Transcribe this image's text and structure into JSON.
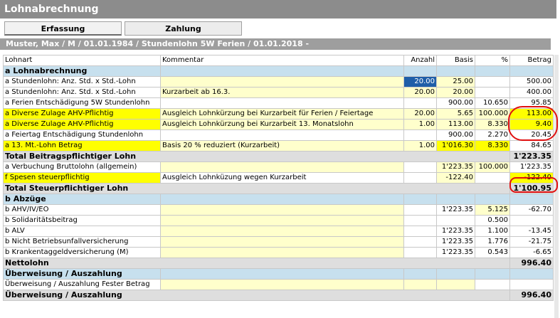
{
  "app": {
    "title": "Lohnabrechnung"
  },
  "tabs": [
    {
      "label": "Erfassung"
    },
    {
      "label": "Zahlung"
    }
  ],
  "employee": {
    "line": "Muster, Max / M / 01.01.1984 / Stundenlohn 5W Ferien / 01.01.2018 -"
  },
  "columns": {
    "lohnart": "Lohnart",
    "kommentar": "Kommentar",
    "anzahl": "Anzahl",
    "basis": "Basis",
    "pct": "%",
    "betrag": "Betrag"
  },
  "rows": [
    {
      "type": "section",
      "label": "a  Lohnabrechnung"
    },
    {
      "type": "item",
      "lohnart": "a  Stundenlohn: Anz. Std. x Std.-Lohn",
      "kommentar": "",
      "anzahl": "20.00",
      "basis": "25.00",
      "pct": "",
      "betrag": "500.00",
      "hl": [],
      "yl": [
        "kommentar",
        "basis"
      ],
      "sel": [
        "anzahl"
      ]
    },
    {
      "type": "item",
      "lohnart": "a  Stundenlohn: Anz. Std. x Std.-Lohn",
      "kommentar": "Kurzarbeit ab 16.3.",
      "anzahl": "20.00",
      "basis": "20.00",
      "pct": "",
      "betrag": "400.00",
      "hl": [],
      "yl": [
        "kommentar",
        "anzahl",
        "basis"
      ],
      "sel": []
    },
    {
      "type": "item",
      "lohnart": "a  Ferien Entschädigung 5W Stundenlohn",
      "kommentar": "",
      "anzahl": "",
      "basis": "900.00",
      "pct": "10.650",
      "betrag": "95.85",
      "hl": [],
      "yl": [],
      "sel": []
    },
    {
      "type": "item",
      "lohnart": "a  Diverse Zulage AHV-Pflichtig",
      "kommentar": "Ausgleich Lohnkürzung bei Kurzarbeit für Ferien / Feiertage",
      "anzahl": "20.00",
      "basis": "5.65",
      "pct": "100.000",
      "betrag": "113.00",
      "hl": [
        "lohnart",
        "betrag"
      ],
      "yl": [
        "kommentar",
        "anzahl",
        "basis",
        "pct"
      ],
      "sel": []
    },
    {
      "type": "item",
      "lohnart": "a  Diverse Zulage AHV-Pflichtig",
      "kommentar": "Ausgleich Lohnkürzung bei Kurzarbeit 13. Monatslohn",
      "anzahl": "1.00",
      "basis": "113.00",
      "pct": "8.330",
      "betrag": "9.40",
      "hl": [
        "lohnart",
        "betrag"
      ],
      "yl": [
        "kommentar",
        "anzahl",
        "basis",
        "pct"
      ],
      "sel": []
    },
    {
      "type": "item",
      "lohnart": "a  Feiertag Entschädigung Stundenlohn",
      "kommentar": "",
      "anzahl": "",
      "basis": "900.00",
      "pct": "2.270",
      "betrag": "20.45",
      "hl": [],
      "yl": [],
      "sel": []
    },
    {
      "type": "item",
      "lohnart": "a  13. Mt.-Lohn Betrag",
      "kommentar": "Basis 20 % reduziert (Kurzarbeit)",
      "anzahl": "1.00",
      "basis": "1'016.30",
      "pct": "8.330",
      "betrag": "84.65",
      "hl": [
        "lohnart",
        "basis",
        "pct"
      ],
      "yl": [
        "kommentar",
        "anzahl"
      ],
      "sel": []
    },
    {
      "type": "total",
      "label": "Total Beitragspflichtiger Lohn",
      "betrag": "1'223.35"
    },
    {
      "type": "item",
      "lohnart": "a  Verbuchung Bruttolohn (allgemein)",
      "kommentar": "",
      "anzahl": "",
      "basis": "1'223.35",
      "pct": "100.000",
      "betrag": "1'223.35",
      "hl": [],
      "yl": [
        "kommentar",
        "basis",
        "pct"
      ],
      "sel": []
    },
    {
      "type": "item",
      "lohnart": "f  Spesen steuerpflichtig",
      "kommentar": "Ausgleich Lohnküzung wegen Kurzarbeit",
      "anzahl": "",
      "basis": "-122.40",
      "pct": "",
      "betrag": "-122.40",
      "hl": [
        "lohnart",
        "betrag"
      ],
      "yl": [
        "basis"
      ],
      "sel": []
    },
    {
      "type": "total",
      "label": "Total Steuerpflichtiger Lohn",
      "betrag": "1'100.95"
    },
    {
      "type": "section",
      "label": "b  Abzüge"
    },
    {
      "type": "item",
      "lohnart": "b  AHV/IV/EO",
      "kommentar": "",
      "anzahl": "",
      "basis": "1'223.35",
      "pct": "5.125",
      "betrag": "-62.70",
      "hl": [],
      "yl": [
        "kommentar",
        "pct"
      ],
      "sel": []
    },
    {
      "type": "item",
      "lohnart": "b  Solidaritätsbeitrag",
      "kommentar": "",
      "anzahl": "",
      "basis": "",
      "pct": "0.500",
      "betrag": "",
      "hl": [],
      "yl": [
        "kommentar"
      ],
      "sel": []
    },
    {
      "type": "item",
      "lohnart": "b  ALV",
      "kommentar": "",
      "anzahl": "",
      "basis": "1'223.35",
      "pct": "1.100",
      "betrag": "-13.45",
      "hl": [],
      "yl": [
        "kommentar"
      ],
      "sel": []
    },
    {
      "type": "item",
      "lohnart": "b  Nicht Betriebsunfallversicherung",
      "kommentar": "",
      "anzahl": "",
      "basis": "1'223.35",
      "pct": "1.776",
      "betrag": "-21.75",
      "hl": [],
      "yl": [
        "kommentar"
      ],
      "sel": []
    },
    {
      "type": "item",
      "lohnart": "b  Krankentaggeldversicherung (M)",
      "kommentar": "",
      "anzahl": "",
      "basis": "1'223.35",
      "pct": "0.543",
      "betrag": "-6.65",
      "hl": [],
      "yl": [
        "kommentar"
      ],
      "sel": []
    },
    {
      "type": "total",
      "label": "Nettolohn",
      "betrag": "996.40"
    },
    {
      "type": "section",
      "label": "Überweisung / Auszahlung"
    },
    {
      "type": "item",
      "lohnart": "Überweisung / Auszahlung Fester Betrag",
      "kommentar": "",
      "anzahl": "",
      "basis": "",
      "pct": "",
      "betrag": "",
      "hl": [],
      "yl": [
        "kommentar",
        "anzahl",
        "basis"
      ],
      "sel": []
    },
    {
      "type": "total",
      "label": "Überweisung / Auszahlung",
      "betrag": "996.40"
    }
  ],
  "colors": {
    "section": "#c7e0ee",
    "total": "#dedede",
    "highlight": "#ffff00",
    "editable": "#ffffcc",
    "selected": "#1f5ea8",
    "annotation": "#e01010"
  }
}
